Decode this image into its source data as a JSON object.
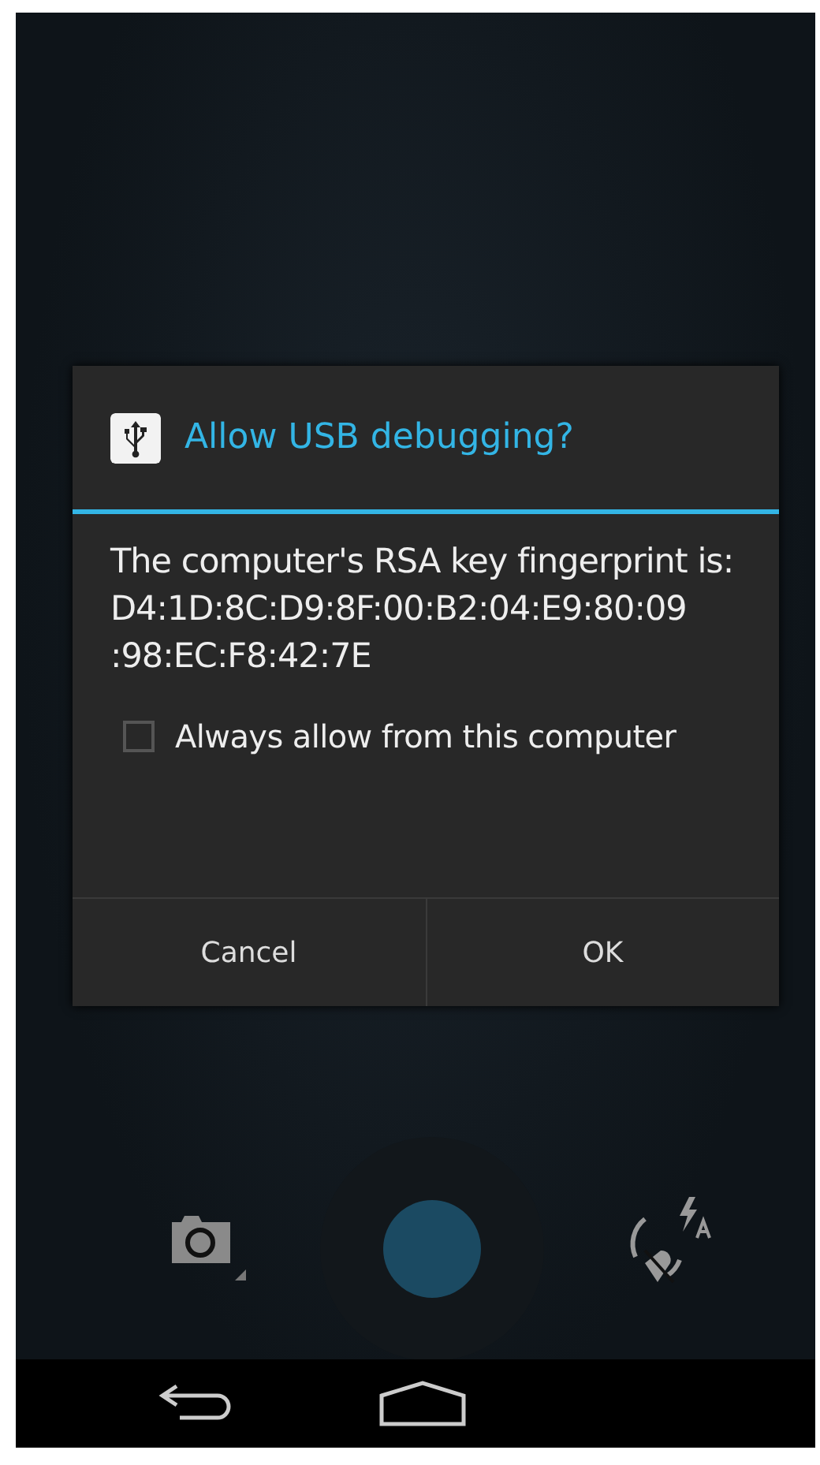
{
  "dialog": {
    "title": "Allow USB debugging?",
    "message": "The computer's RSA key fingerprint is: D4:1D:8C:D9:8F:00:B2:04:E9:80:09\n:98:EC:F8:42:7E",
    "checkbox": {
      "label": "Always allow from this computer",
      "checked": false
    },
    "buttons": [
      "Cancel",
      "OK"
    ]
  }
}
